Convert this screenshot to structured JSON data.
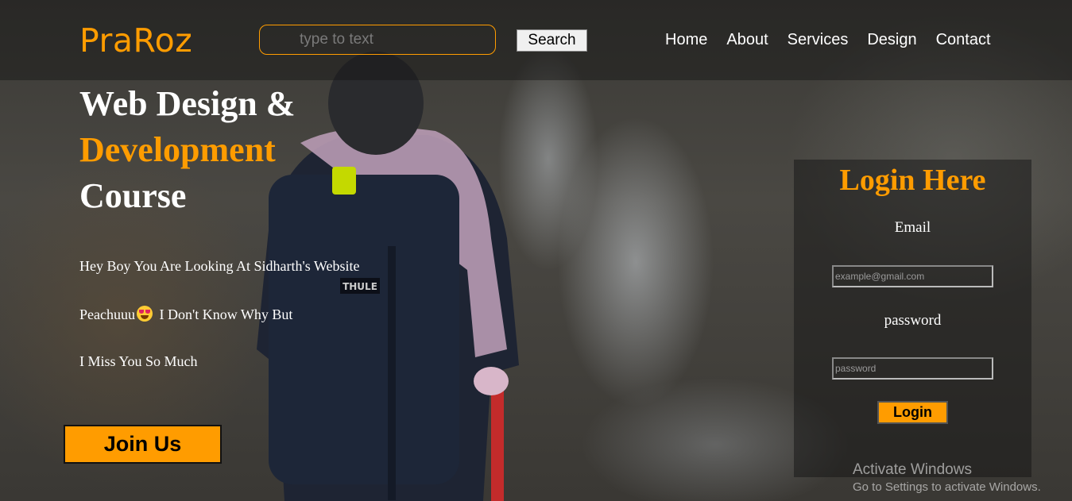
{
  "header": {
    "logo": "PraRoz",
    "search": {
      "placeholder": "type to text",
      "value": ""
    },
    "search_button": "Search",
    "nav": [
      "Home",
      "About",
      "Services",
      "Design",
      "Contact"
    ]
  },
  "hero": {
    "title_line1": "Web Design &",
    "title_line2": "Development",
    "title_line3": "Course",
    "para1": "Hey Boy You Are Looking At Sidharth's Website",
    "para2_before": "Peachuuu",
    "para2_emoji": "heart-eyes-emoji",
    "para2_after": "I Don't Know Why But",
    "para3": "I Miss You So Much",
    "join_button": "Join Us"
  },
  "login": {
    "title": "Login Here",
    "email_label": "Email",
    "email_placeholder": "example@gmail.com",
    "password_label": "password",
    "password_placeholder": "password",
    "button": "Login"
  },
  "watermark": {
    "line1": "Activate Windows",
    "line2": "Go to Settings to activate Windows."
  },
  "colors": {
    "accent": "#ff9c00"
  }
}
